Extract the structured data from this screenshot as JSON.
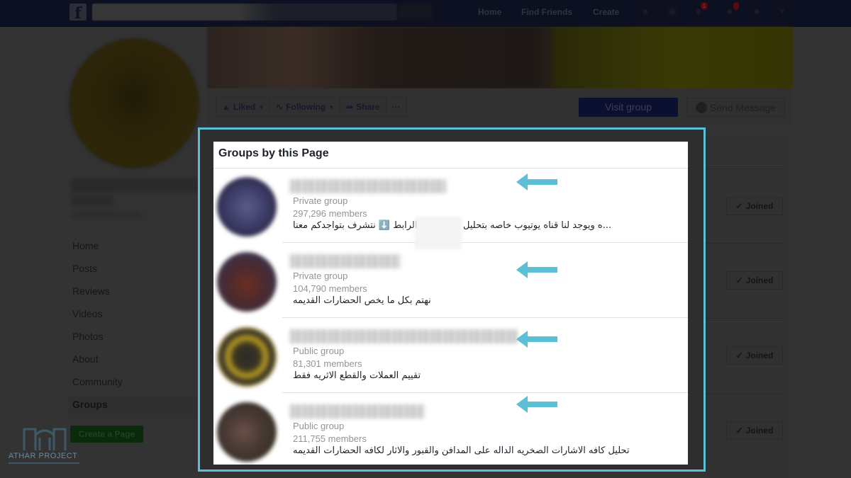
{
  "topbar": {
    "logo": "f",
    "nav_links": [
      "Home",
      "Find Friends",
      "Create"
    ],
    "notification_count": "1",
    "icons": [
      "friends-icon",
      "messenger-icon",
      "notifications-icon",
      "quick-help-icon",
      "help-icon",
      "account-menu-icon"
    ]
  },
  "actions": {
    "liked": "Liked",
    "following": "Following",
    "share": "Share",
    "more": "···",
    "visit_group": "Visit group",
    "send_message": "Send Message"
  },
  "left_nav": {
    "items": [
      "Home",
      "Posts",
      "Reviews",
      "Videos",
      "Photos",
      "About",
      "Community",
      "Groups"
    ],
    "active": "Groups",
    "create_page": "Create a Page"
  },
  "watermark": {
    "text": "ATHAR PROJECT"
  },
  "groups_panel": {
    "title": "Groups by this Page",
    "groups": [
      {
        "type": "Private group",
        "members": "297,296 members",
        "description": "...ه ويوجد لنا قناه يوتيوب خاصه بتحليل جميع الاشـ           الرابط ⬇️ نتشرف بتواجدكم معنا",
        "joined": "Joined"
      },
      {
        "type": "Private group",
        "members": "104,790 members",
        "description": "نهتم بكل ما يخص الحضارات القديمه",
        "joined": "Joined"
      },
      {
        "type": "Public group",
        "members": "81,301 members",
        "description": "تقييم العملات والقطع الاثريه فقط",
        "joined": "Joined"
      },
      {
        "type": "Public group",
        "members": "211,755 members",
        "description": "تحليل كافه الاشارات الصخريه الداله على المدافن والقبور والاثار لكافه الحضارات القديمه",
        "joined": "Joined"
      }
    ]
  },
  "colors": {
    "highlight": "#5bc0d6",
    "arrow": "#5bc0d6",
    "overlay_bg": "#333333"
  }
}
